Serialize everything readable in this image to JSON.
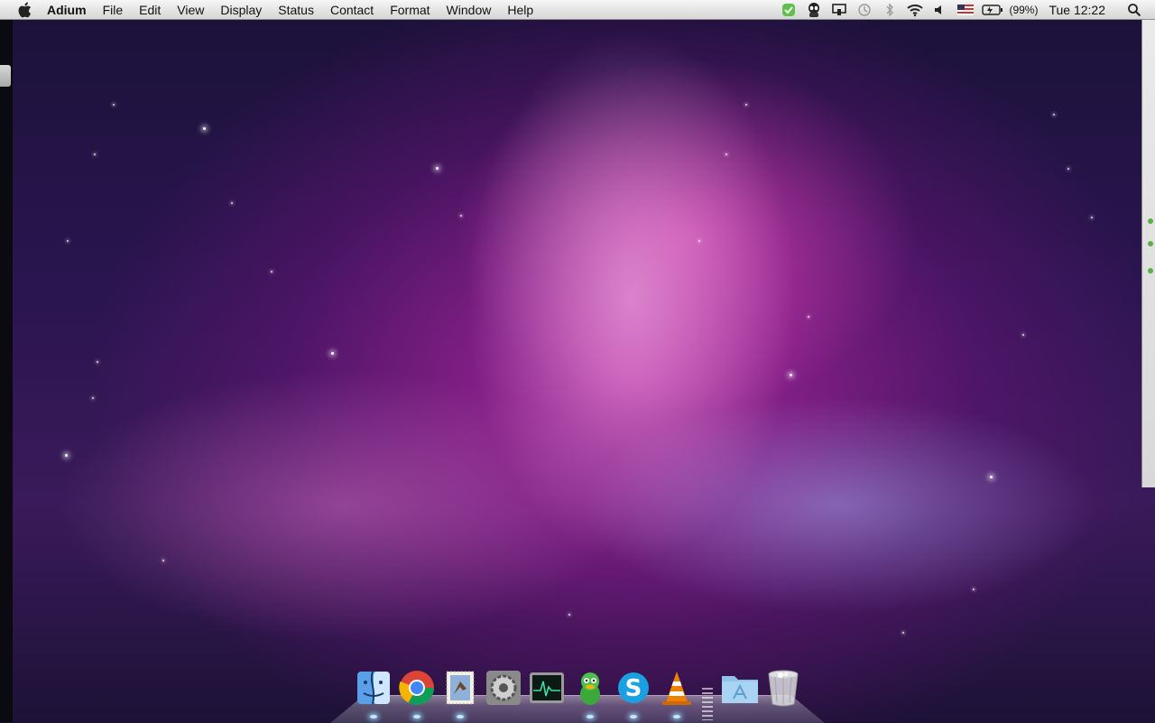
{
  "menubar": {
    "app_name": "Adium",
    "menus": [
      "File",
      "Edit",
      "View",
      "Display",
      "Status",
      "Contact",
      "Format",
      "Window",
      "Help"
    ],
    "battery_text": "(99%)",
    "clock": "Tue 12:22"
  },
  "status_icons": [
    "adium-status-icon",
    "alien-menu-icon",
    "airplay-icon",
    "time-machine-icon",
    "bluetooth-icon",
    "wifi-icon",
    "volume-icon",
    "flag-us-icon",
    "battery-icon",
    "spotlight-icon"
  ],
  "dock": {
    "apps": [
      "Finder",
      "Google Chrome",
      "Mail",
      "System Preferences",
      "Activity Monitor",
      "Adium",
      "Skype",
      "VLC"
    ],
    "stacks": [
      "Applications",
      "Trash"
    ]
  },
  "colors": {
    "menubar_top": "#f6f6f6",
    "menubar_bottom": "#d6d6d6",
    "wallpaper_pink": "#c02aaa",
    "wallpaper_dark": "#1a1238"
  }
}
